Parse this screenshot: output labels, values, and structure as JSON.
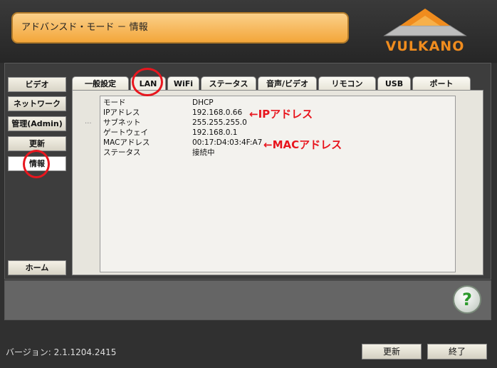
{
  "header": {
    "title": "アドバンスド・モード － 情報",
    "logo_text": "VULKANO"
  },
  "sidebar": {
    "items": [
      {
        "label": "ビデオ"
      },
      {
        "label": "ネットワーク"
      },
      {
        "label": "管理(Admin)"
      },
      {
        "label": "更新"
      },
      {
        "label": "情報"
      }
    ],
    "home_label": "ホーム"
  },
  "tabs": [
    {
      "label": "一般設定"
    },
    {
      "label": "LAN"
    },
    {
      "label": "WiFi"
    },
    {
      "label": "ステータス"
    },
    {
      "label": "音声/ビデオ"
    },
    {
      "label": "リモコン"
    },
    {
      "label": "USB"
    },
    {
      "label": "ポート"
    }
  ],
  "info": {
    "rows": [
      {
        "label": "モード",
        "value": "DHCP"
      },
      {
        "label": "IPアドレス",
        "value": "192.168.0.66"
      },
      {
        "label": "サブネット",
        "value": "255.255.255.0"
      },
      {
        "label": "ゲートウェイ",
        "value": "192.168.0.1"
      },
      {
        "label": "MACアドレス",
        "value": "00:17:D4:03:4F:A7"
      },
      {
        "label": "ステータス",
        "value": "接続中"
      }
    ],
    "dots": "..."
  },
  "annotations": {
    "ip": "←IPアドレス",
    "mac": "←MACアドレス"
  },
  "help": {
    "label": "?"
  },
  "footer": {
    "version": "バージョン: 2.1.1204.2415",
    "update_label": "更新",
    "exit_label": "終了"
  },
  "colors": {
    "accent_orange": "#f3a63a",
    "annotation_red": "#e8161e",
    "help_green": "#2e9a2e"
  }
}
